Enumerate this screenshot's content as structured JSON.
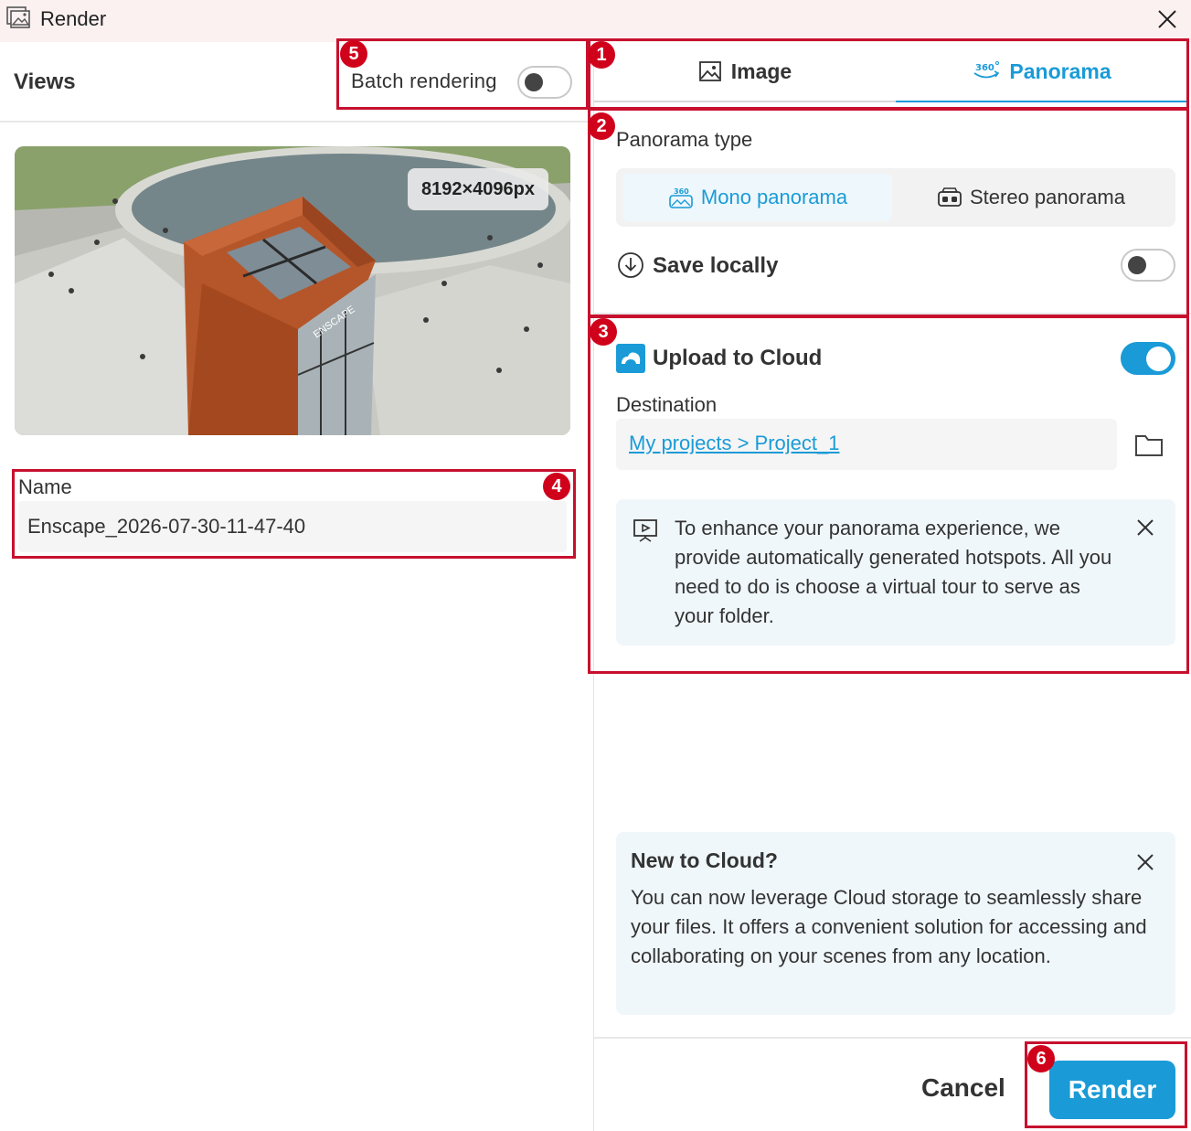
{
  "window": {
    "title": "Render"
  },
  "views": {
    "title": "Views",
    "batch_label": "Batch rendering",
    "batch_on": false,
    "resolution": "8192×4096px",
    "name_label": "Name",
    "name_value": "Enscape_2026-07-30-11-47-40"
  },
  "tabs": [
    {
      "label": "Image",
      "icon": "image-icon",
      "selected": false
    },
    {
      "label": "Panorama",
      "icon": "panorama-360-icon",
      "selected": true
    }
  ],
  "panorama": {
    "type_label": "Panorama type",
    "options": [
      {
        "label": "Mono panorama",
        "icon": "mono-panorama-icon",
        "selected": true
      },
      {
        "label": "Stereo panorama",
        "icon": "vr-headset-icon",
        "selected": false
      }
    ],
    "save_locally": {
      "label": "Save locally",
      "on": false
    }
  },
  "cloud": {
    "label": "Upload to Cloud",
    "on": true,
    "destination_label": "Destination",
    "destination_path": "My projects > Project_1",
    "hotspot_info": "To enhance your panorama experience, we provide automatically generated hotspots. All you need to do is choose a virtual tour to serve as your folder."
  },
  "new_to_cloud": {
    "title": "New to Cloud?",
    "text": "You can now leverage Cloud storage to seamlessly share your files. It offers a convenient solution for accessing and collaborating on your scenes from any location."
  },
  "footer": {
    "cancel": "Cancel",
    "render": "Render"
  },
  "markers": [
    "1",
    "2",
    "3",
    "4",
    "5",
    "6"
  ],
  "colors": {
    "accent": "#1a9bd7",
    "highlight": "#c8102e",
    "marker": "#d0021b",
    "titlebar": "#fbf1f1"
  }
}
